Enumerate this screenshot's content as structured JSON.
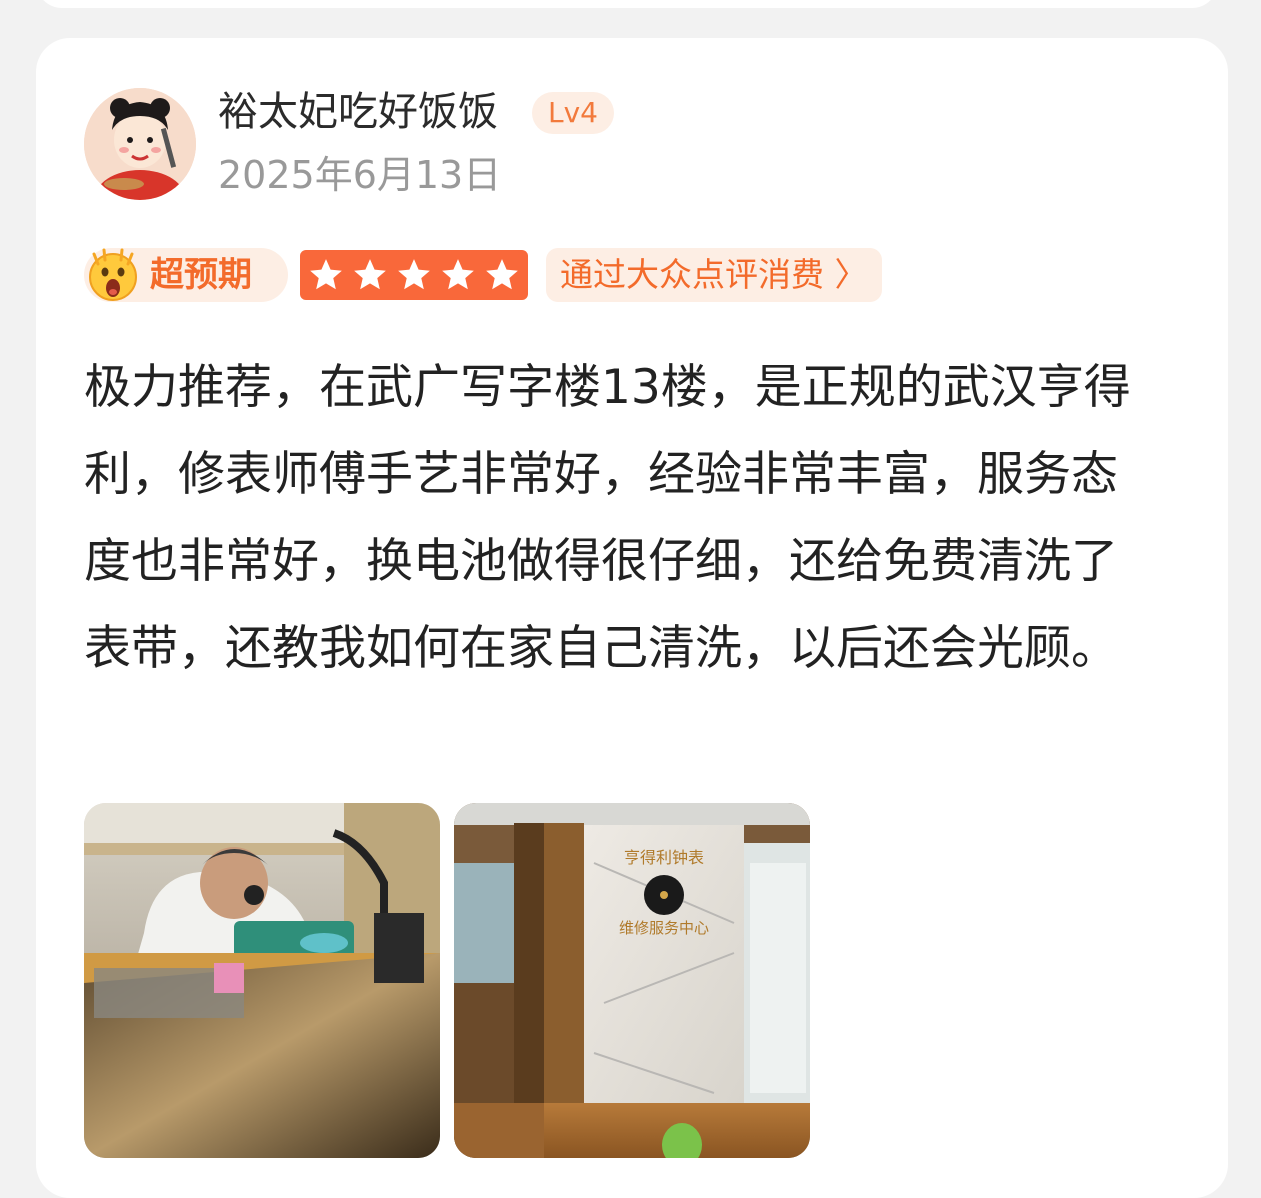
{
  "review": {
    "user": {
      "name": "裕太妃吃好饭饭",
      "level": "Lv4",
      "avatar": "cartoon-avatar"
    },
    "date": "2025年6月13日",
    "sentiment_label": "超预期",
    "sentiment_icon": "astonished-face-icon",
    "rating": {
      "stars": 5,
      "max": 5
    },
    "source_link": "通过大众点评消费 〉",
    "text": "极力推荐，在武广写字楼13楼，是正规的武汉亨得利，修表师傅手艺非常好，经验非常丰富，服务态度也非常好，换电池做得很仔细，还给免费清洗了表带，还教我如何在家自己清洗，以后还会光顾。",
    "photos": [
      {
        "name": "watchmaker-photo"
      },
      {
        "name": "store-entrance-photo",
        "wall_sign": [
          "亨得利钟表",
          "维修服务中心"
        ]
      }
    ]
  },
  "colors": {
    "accent": "#f36b2b",
    "star_bg": "#f9683a",
    "pill_bg": "#fdeee4",
    "text": "#222222",
    "muted": "#999999"
  }
}
